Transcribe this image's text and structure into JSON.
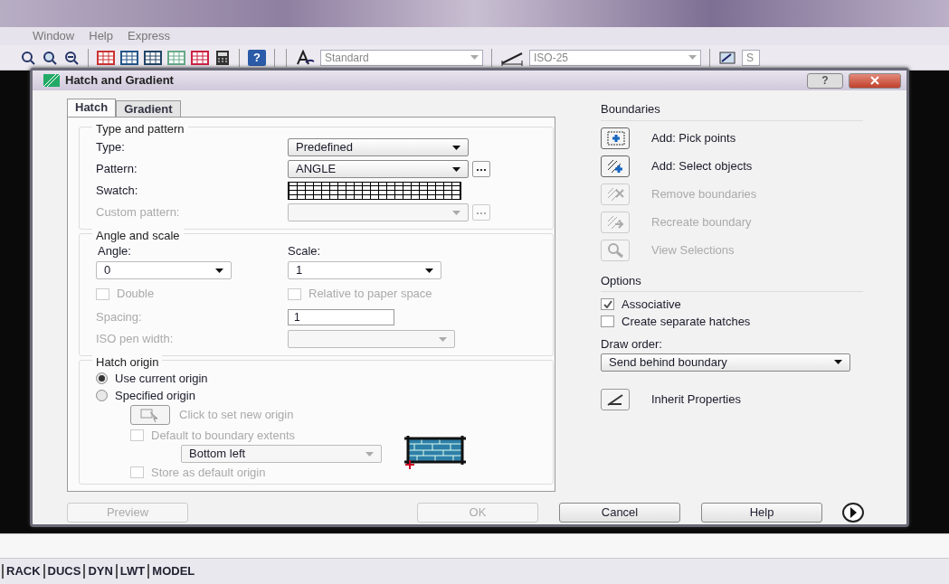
{
  "menu": [
    {
      "label": "Window"
    },
    {
      "label": "Help"
    },
    {
      "label": "Express"
    }
  ],
  "toolbar": {
    "help_glyph": "?",
    "text_style": "Standard",
    "dim_style": "ISO-25",
    "cut_combo": "S"
  },
  "dialog": {
    "title": "Hatch and Gradient",
    "help_button": "?",
    "tabs": [
      {
        "label": "Hatch",
        "selected": true
      },
      {
        "label": "Gradient",
        "selected": false
      }
    ],
    "type_and_pattern": {
      "title": "Type and pattern",
      "fields": [
        {
          "kind": "select",
          "label": "Type:",
          "value": "Predefined",
          "disabled": false,
          "browse": false
        },
        {
          "kind": "select",
          "label": "Pattern:",
          "value": "ANGLE",
          "disabled": false,
          "browse": true
        },
        {
          "kind": "swatch",
          "label": "Swatch:",
          "disabled": false
        },
        {
          "kind": "select",
          "label": "Custom pattern:",
          "disabled": true,
          "browse": true
        }
      ]
    },
    "angle_and_scale": {
      "title": "Angle and scale",
      "angle": {
        "label": "Angle:",
        "value": "0"
      },
      "scale": {
        "label": "Scale:",
        "value": "1"
      },
      "checks": [
        {
          "label": "Double",
          "checked": false,
          "disabled": true
        },
        {
          "label": "Relative to paper space",
          "checked": false,
          "disabled": true
        }
      ],
      "spacing": {
        "label": "Spacing:",
        "value": "1",
        "disabled": true
      },
      "iso_pen_width": {
        "label": "ISO pen width:",
        "disabled": true
      }
    },
    "hatch_origin": {
      "title": "Hatch origin",
      "radios": [
        {
          "label": "Use current origin",
          "selected": true
        },
        {
          "label": "Specified origin",
          "selected": false
        }
      ],
      "set_origin": {
        "label": "Click to set new origin",
        "disabled": true
      },
      "default_extents": {
        "label": "Default to boundary extents",
        "checked": false,
        "disabled": true
      },
      "position": {
        "value": "Bottom left",
        "disabled": true
      },
      "store_default": {
        "label": "Store as default origin",
        "checked": false,
        "disabled": true
      }
    },
    "boundaries": {
      "title": "Boundaries",
      "actions": [
        {
          "kind": "pick",
          "label": "Add: Pick points",
          "disabled": false
        },
        {
          "kind": "select",
          "label": "Add: Select objects",
          "disabled": false
        },
        {
          "kind": "remove",
          "label": "Remove boundaries",
          "disabled": true
        },
        {
          "kind": "recreate",
          "label": "Recreate boundary",
          "disabled": true
        },
        {
          "kind": "view",
          "label": "View Selections",
          "disabled": true
        }
      ]
    },
    "options": {
      "title": "Options",
      "checks": [
        {
          "label": "Associative",
          "checked": true
        },
        {
          "label": "Create separate hatches",
          "checked": false
        }
      ],
      "draw_order": {
        "label": "Draw order:",
        "value": "Send behind boundary"
      },
      "inherit": {
        "label": "Inherit Properties"
      }
    },
    "buttons": [
      {
        "label": "Preview",
        "disabled": true
      },
      {
        "label": "OK",
        "disabled": true
      },
      {
        "label": "Cancel",
        "disabled": false
      },
      {
        "label": "Help",
        "disabled": false
      }
    ]
  },
  "status_bar": [
    {
      "label": "RACK"
    },
    {
      "label": "DUCS"
    },
    {
      "label": "DYN"
    },
    {
      "label": "LWT"
    },
    {
      "label": "MODEL"
    }
  ]
}
